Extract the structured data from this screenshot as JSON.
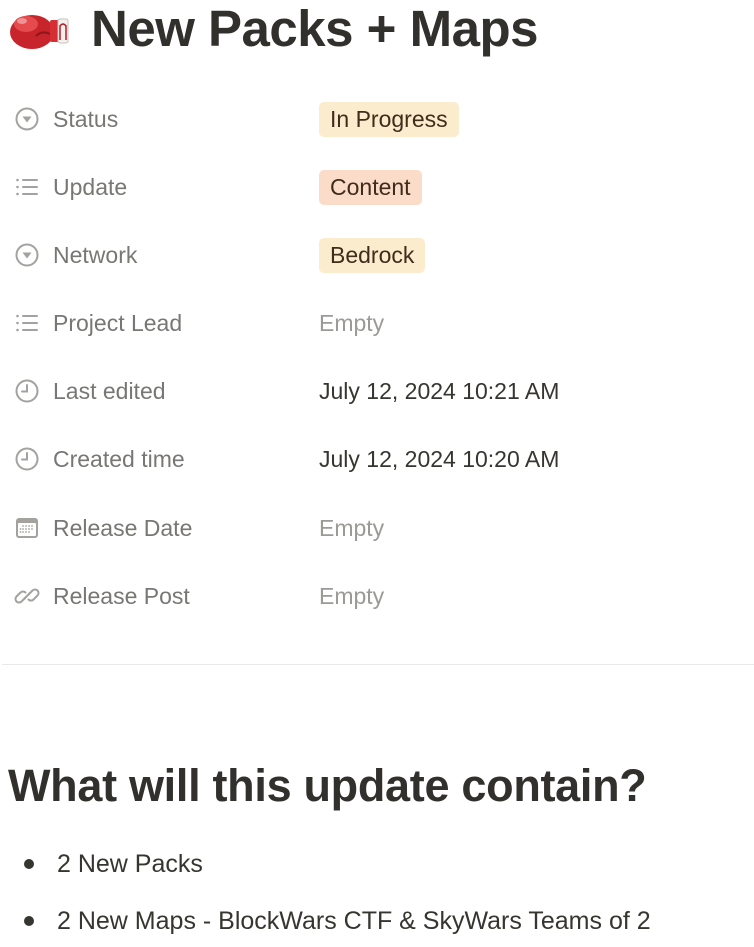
{
  "page": {
    "icon": "boxing-glove-icon",
    "title": "New Packs + Maps"
  },
  "properties": [
    {
      "icon": "status-select-icon",
      "label": "Status",
      "value": "In Progress",
      "type": "tag",
      "tag_color": "#fbeccd"
    },
    {
      "icon": "multi-select-list-icon",
      "label": "Update",
      "value": "Content",
      "type": "tag",
      "tag_color": "#fadcc9"
    },
    {
      "icon": "select-icon",
      "label": "Network",
      "value": "Bedrock",
      "type": "tag",
      "tag_color": "#fbeccd"
    },
    {
      "icon": "multi-select-list-icon",
      "label": "Project Lead",
      "value": "Empty",
      "type": "empty"
    },
    {
      "icon": "clock-icon",
      "label": "Last edited",
      "value": "July 12, 2024 10:21 AM",
      "type": "datetime"
    },
    {
      "icon": "clock-icon",
      "label": "Created time",
      "value": "July 12, 2024 10:20 AM",
      "type": "datetime"
    },
    {
      "icon": "calendar-icon",
      "label": "Release Date",
      "value": "Empty",
      "type": "empty"
    },
    {
      "icon": "link-icon",
      "label": "Release Post",
      "value": "Empty",
      "type": "empty"
    }
  ],
  "content": {
    "heading": "What will this update contain?",
    "bullets": [
      "2 New Packs",
      "2 New Maps - BlockWars CTF & SkyWars Teams of 2"
    ]
  },
  "colors": {
    "text": "#37352f",
    "label": "#787774",
    "empty": "#9b9a97",
    "tag_text": "#402c1b",
    "divider": "#e9e9e7"
  }
}
